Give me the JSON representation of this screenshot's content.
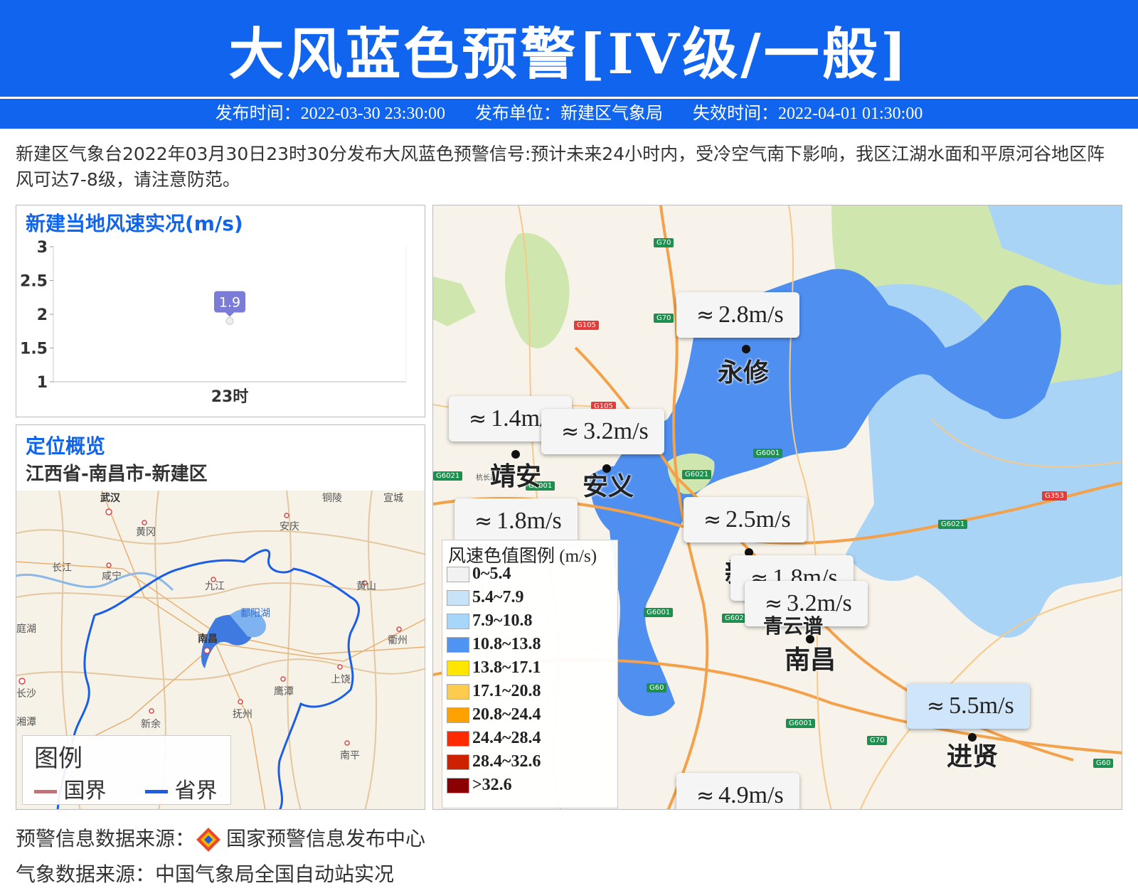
{
  "header": {
    "title": "大风蓝色预警[IV级/一般]",
    "publish_time": "发布时间：2022-03-30 23:30:00",
    "publisher": "发布单位：新建区气象局",
    "expire_time": "失效时间：2022-04-01 01:30:00",
    "color": "#1064ee"
  },
  "description": "新建区气象台2022年03月30日23时30分发布大风蓝色预警信号:预计未来24小时内，受冷空气南下影响，我区江湖水面和平原河谷地区阵风可达7-8级，请注意防范。",
  "wind_chart": {
    "title": "新建当地风速实况(m/s)",
    "chart_data": {
      "type": "scatter",
      "categories": [
        "23时"
      ],
      "values": [
        1.9
      ],
      "ylim": [
        1,
        3
      ],
      "yticks": [
        "3",
        "2.5",
        "2",
        "1.5",
        "1"
      ],
      "data_label": "1.9",
      "label_color": "#7b7bd8"
    }
  },
  "location": {
    "title": "定位概览",
    "path": "江西省-南昌市-新建区",
    "legend_title": "图例",
    "legend_items": [
      {
        "label": "国界",
        "color": "#c8707a"
      },
      {
        "label": "省界",
        "color": "#1a5ee8"
      }
    ],
    "cities": [
      "武汉",
      "黄冈",
      "铜陵",
      "宣城",
      "安庆",
      "长江",
      "咸宁",
      "九江",
      "黄山",
      "鄱阳湖",
      "南昌",
      "衢州",
      "庭湖",
      "上饶",
      "鹰潭",
      "长沙",
      "抚州",
      "湘潭",
      "新余",
      "南平"
    ]
  },
  "map": {
    "stations": [
      {
        "name": "永修",
        "wind": "2.8m/s"
      },
      {
        "name": "靖安",
        "wind": "1.4m/s"
      },
      {
        "name": "安义",
        "wind": "3.2m/s"
      },
      {
        "name": "",
        "wind": "1.8m/s"
      },
      {
        "name": "新建",
        "wind": "2.5m/s"
      },
      {
        "name": "",
        "wind": "1.8m/s"
      },
      {
        "name": "南昌",
        "wind": "3.2m/s"
      },
      {
        "name": "进贤",
        "wind": "5.5m/s"
      },
      {
        "name": "",
        "wind": "4.9m/s"
      }
    ],
    "extra_place": "青云谱",
    "road_labels": [
      "G70",
      "G70",
      "G105",
      "G105",
      "G6001",
      "G6021",
      "G6021",
      "G6001",
      "G353",
      "G6021",
      "G6001",
      "G6021",
      "G60",
      "G6001",
      "G70",
      "G60",
      "杭长高"
    ],
    "legend": {
      "title": "风速色值图例 (m/s)",
      "items": [
        {
          "label": "0~5.4",
          "color": "#f2f2f2"
        },
        {
          "label": "5.4~7.9",
          "color": "#c8e2f8"
        },
        {
          "label": "7.9~10.8",
          "color": "#a7d6fb"
        },
        {
          "label": "10.8~13.8",
          "color": "#4f94f2"
        },
        {
          "label": "13.8~17.1",
          "color": "#ffe600"
        },
        {
          "label": "17.1~20.8",
          "color": "#fdcc4e"
        },
        {
          "label": "20.8~24.4",
          "color": "#ffa200"
        },
        {
          "label": "24.4~28.4",
          "color": "#ff2a00"
        },
        {
          "label": "28.4~32.6",
          "color": "#cc2200"
        },
        {
          "label": ">32.6",
          "color": "#8b0000"
        }
      ]
    }
  },
  "footer": {
    "warning_source_label": "预警信息数据来源：",
    "warning_source": "国家预警信息发布中心",
    "weather_source": "气象数据来源：中国气象局全国自动站实况"
  }
}
